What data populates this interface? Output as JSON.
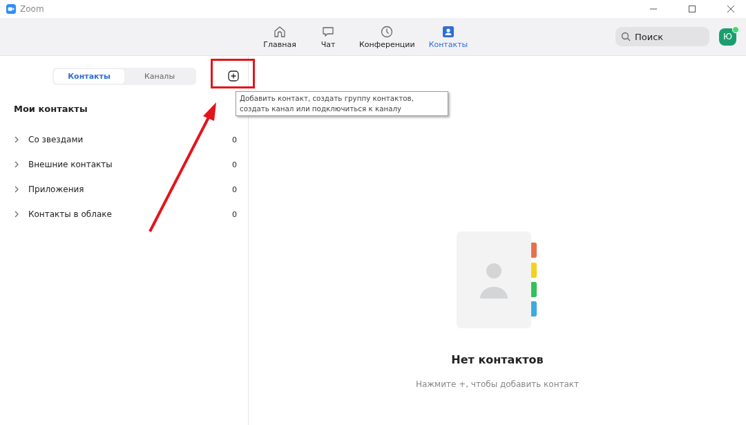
{
  "window": {
    "title": "Zoom"
  },
  "nav": [
    {
      "kind": "home",
      "label": "Главная",
      "selected": false
    },
    {
      "kind": "chat",
      "label": "Чат",
      "selected": false
    },
    {
      "kind": "meetings",
      "label": "Конференции",
      "selected": false
    },
    {
      "kind": "contacts",
      "label": "Контакты",
      "selected": true
    }
  ],
  "search": {
    "placeholder": "Поиск"
  },
  "avatar": {
    "initial": "Ю",
    "online": true
  },
  "segments": [
    {
      "label": "Контакты",
      "selected": true
    },
    {
      "label": "Каналы",
      "selected": false
    }
  ],
  "tooltip": "Добавить контакт, создать группу контактов, создать канал или подключиться к каналу",
  "section_title": "Мои контакты",
  "groups": [
    {
      "label": "Со звездами",
      "count": "0",
      "expanded": false
    },
    {
      "label": "Внешние контакты",
      "count": "0",
      "expanded": false
    },
    {
      "label": "Приложения",
      "count": "0",
      "expanded": false
    },
    {
      "label": "Контакты в облаке",
      "count": "0",
      "expanded": false
    }
  ],
  "empty_state": {
    "title": "Нет контактов",
    "hint": "Нажмите +, чтобы добавить контакт"
  }
}
